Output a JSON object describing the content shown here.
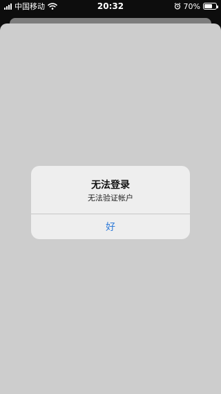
{
  "status_bar": {
    "carrier": "中国移动",
    "time": "20:32",
    "battery_percent": "70%",
    "battery_level": 0.7,
    "signal_bars": 4,
    "icons": [
      "signal-icon",
      "wifi-icon",
      "alarm-icon",
      "battery-icon"
    ]
  },
  "alert": {
    "title": "无法登录",
    "message": "无法验证帐户",
    "button_label": "好",
    "button_color": "#2f7bd9"
  }
}
